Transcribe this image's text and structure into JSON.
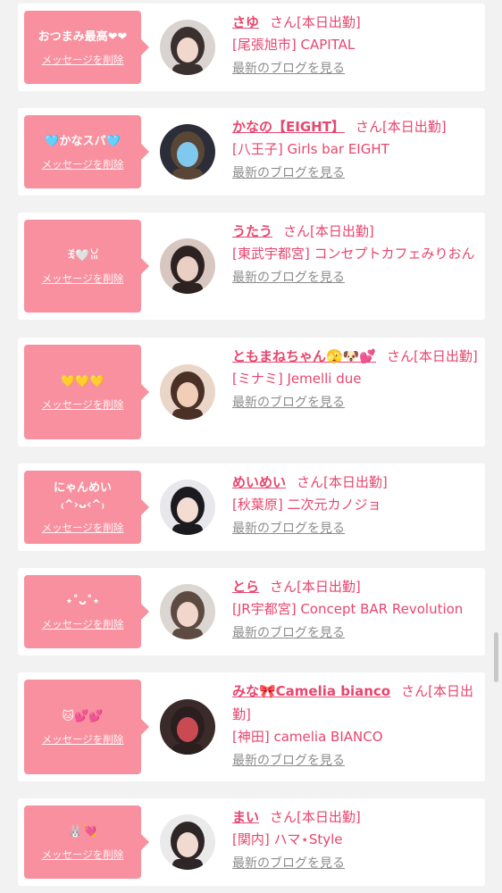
{
  "cards": [
    {
      "message": "おつまみ最高❤❤",
      "delete_label": "メッセージを削除",
      "name": "さゆ",
      "status": "さん[本日出勤]",
      "shop": "[尾張旭市] CAPITAL",
      "blog_label": "最新のブログを見る",
      "avatar_icon": "girl-photo-avatar"
    },
    {
      "message": "🩵かなスパ🩵",
      "delete_label": "メッセージを削除",
      "name": "かなの【EIGHT】",
      "status": "さん[本日出勤]",
      "shop": "[八王子] Girls bar EIGHT",
      "blog_label": "最新のブログを見る",
      "avatar_icon": "girl-photo-avatar"
    },
    {
      "message": "ꉂ🤍ꈍ",
      "delete_label": "メッセージを削除",
      "name": "うたう",
      "status": "さん[本日出勤]",
      "shop": "[東武宇都宮] コンセプトカフェみりおん",
      "blog_label": "最新のブログを見る",
      "avatar_icon": "girl-photo-avatar"
    },
    {
      "message": "💛💛💛",
      "delete_label": "メッセージを削除",
      "name": "ともまねちゃん🫣🐶💕",
      "status": "さん[本日出勤]",
      "shop": "[ミナミ] Jemelli due",
      "blog_label": "最新のブログを見る",
      "avatar_icon": "girl-photo-avatar"
    },
    {
      "message": "にゃんめい\n₍^›ᴗ‹^₎",
      "delete_label": "メッセージを削除",
      "name": "めいめい",
      "status": "さん[本日出勤]",
      "shop": "[秋葉原] 二次元カノジョ",
      "blog_label": "最新のブログを見る",
      "avatar_icon": "girl-photo-avatar"
    },
    {
      "message": "⋆˚ᴗ˚⋆",
      "delete_label": "メッセージを削除",
      "name": "とら",
      "status": "さん[本日出勤]",
      "shop": "[JR宇都宮] Concept BAR Revolution",
      "blog_label": "最新のブログを見る",
      "avatar_icon": "girl-photo-avatar"
    },
    {
      "message": "🐱💕💕",
      "delete_label": "メッセージを削除",
      "name": "みな🎀Camelia bianco",
      "status": "さん[本日出勤]",
      "shop": "[神田] camelia BIANCO",
      "blog_label": "最新のブログを見る",
      "avatar_icon": "girl-photo-avatar"
    },
    {
      "message": "🐰💘",
      "delete_label": "メッセージを削除",
      "name": "まい",
      "status": "さん[本日出勤]",
      "shop": "[関内] ハマ⋆Style",
      "blog_label": "最新のブログを見る",
      "avatar_icon": "girl-photo-avatar"
    }
  ],
  "colors": {
    "bubble": "#f8909f",
    "accent": "#e8466e",
    "blog": "#8c8c8c",
    "background": "#f2f2f2"
  }
}
